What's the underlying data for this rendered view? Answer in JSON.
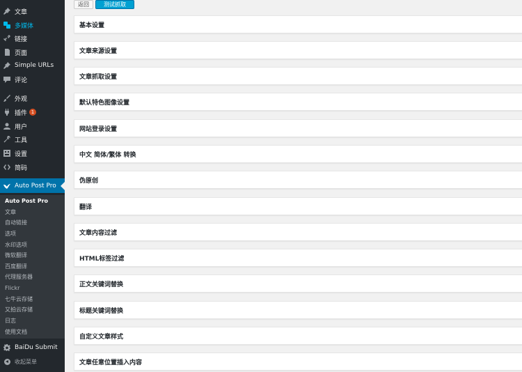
{
  "sidebar": {
    "items": [
      {
        "label": "文章",
        "icon": "pin-icon"
      },
      {
        "label": "多媒体",
        "icon": "media-icon",
        "highlight": true
      },
      {
        "label": "链接",
        "icon": "link-icon"
      },
      {
        "label": "页面",
        "icon": "page-icon"
      },
      {
        "label": "Simple URLs",
        "icon": "pin-icon"
      },
      {
        "label": "评论",
        "icon": "comment-icon"
      },
      {
        "label": "外观",
        "icon": "brush-icon"
      },
      {
        "label": "插件",
        "icon": "plugin-icon",
        "badge": "1"
      },
      {
        "label": "用户",
        "icon": "user-icon"
      },
      {
        "label": "工具",
        "icon": "wrench-icon"
      },
      {
        "label": "设置",
        "icon": "settings-icon"
      },
      {
        "label": "简码",
        "icon": "code-icon"
      }
    ],
    "current": {
      "label": "Auto Post Pro",
      "icon": "bird-icon"
    },
    "submenu": [
      "Auto Post Pro",
      "文章",
      "自动链接",
      "选项",
      "水印选项",
      "微软翻译",
      "百度翻译",
      "代理服务器",
      "Flickr",
      "七牛云存储",
      "又拍云存储",
      "日志",
      "使用文档"
    ],
    "after": {
      "label": "BaiDu Submit",
      "icon": "gear-icon"
    },
    "collapse": "收起菜单"
  },
  "toolbar": {
    "back_label": "返回",
    "test_label": "测试抓取"
  },
  "panels": [
    "基本设置",
    "文章来源设置",
    "文章抓取设置",
    "默认特色图像设置",
    "网站登录设置",
    "中文 简体/繁体 转换",
    "伪原创",
    "翻译",
    "文章内容过滤",
    "HTML标签过滤",
    "正文关键词替换",
    "标题关键词替换",
    "自定义文章样式",
    "文章任意位置插入内容"
  ],
  "colors": {
    "sidebar_bg": "#23282d",
    "submenu_bg": "#32373c",
    "current_bg": "#0073aa",
    "accent": "#00a0d2",
    "badge": "#d54e21"
  }
}
